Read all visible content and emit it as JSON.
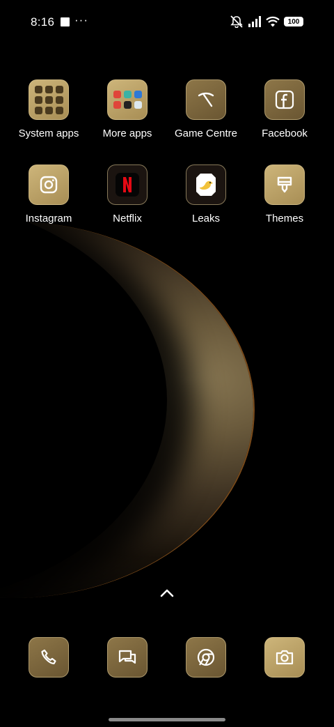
{
  "status_bar": {
    "time": "8:16",
    "battery": "100",
    "icons": [
      "screenshot-indicator-icon",
      "more-notifications-icon",
      "mute-icon",
      "signal-icon",
      "wifi-icon",
      "battery-icon"
    ]
  },
  "home": {
    "apps": [
      {
        "label": "System apps",
        "icon": "folder-icon"
      },
      {
        "label": "More apps",
        "icon": "folder-icon"
      },
      {
        "label": "Game Centre",
        "icon": "game-centre-icon"
      },
      {
        "label": "Facebook",
        "icon": "facebook-icon"
      },
      {
        "label": "Instagram",
        "icon": "instagram-icon"
      },
      {
        "label": "Netflix",
        "icon": "netflix-icon"
      },
      {
        "label": "Leaks",
        "icon": "leaks-bird-icon"
      },
      {
        "label": "Themes",
        "icon": "themes-brush-icon"
      }
    ],
    "folder_more_apps_colors": [
      "#e0453a",
      "#3bb2a5",
      "#2f79d6",
      "#e0453a",
      "#222222",
      "#dde8ee"
    ]
  },
  "dock": {
    "items": [
      "phone-icon",
      "messages-icon",
      "chrome-icon",
      "camera-icon"
    ]
  },
  "colors": {
    "icon_gold": "#c2a96e",
    "icon_gold_dark": "#7b6540",
    "netflix_red": "#e50914"
  }
}
